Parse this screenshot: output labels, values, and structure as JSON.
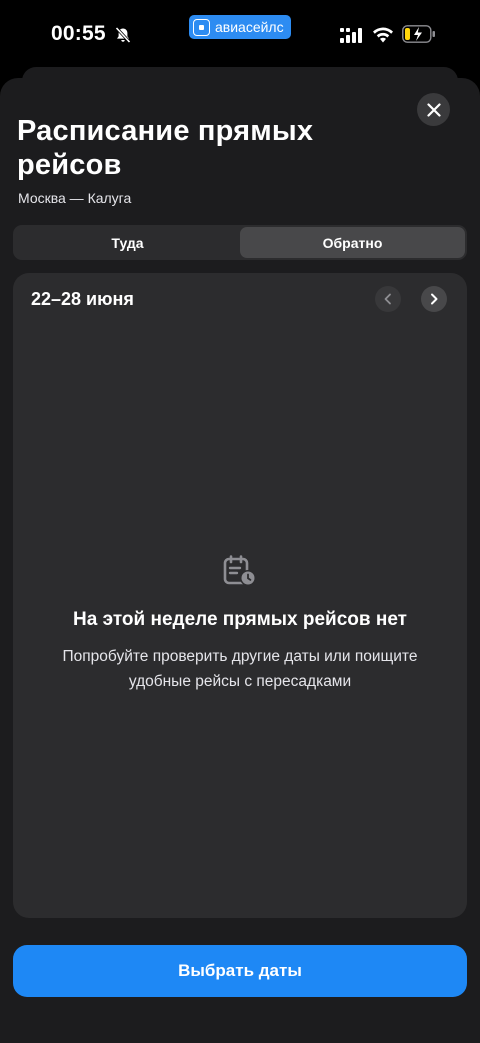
{
  "status_bar": {
    "time": "00:55",
    "app_label": "авиасейлс",
    "accent": "#2d8cf2"
  },
  "sheet": {
    "title": "Расписание прямых рейсов",
    "route": "Москва — Калуга",
    "close_icon": "close-icon"
  },
  "tabs": [
    {
      "label": "Туда",
      "selected": false
    },
    {
      "label": "Обратно",
      "selected": true
    }
  ],
  "week": {
    "range_label": "22–28 июня"
  },
  "empty_state": {
    "icon": "calendar-clock-icon",
    "title": "На этой неделе прямых рейсов нет",
    "text": "Попробуйте проверить другие даты или поищите удобные рейсы с пересадками"
  },
  "cta": {
    "label": "Выбрать даты",
    "color": "#1e88f5"
  }
}
